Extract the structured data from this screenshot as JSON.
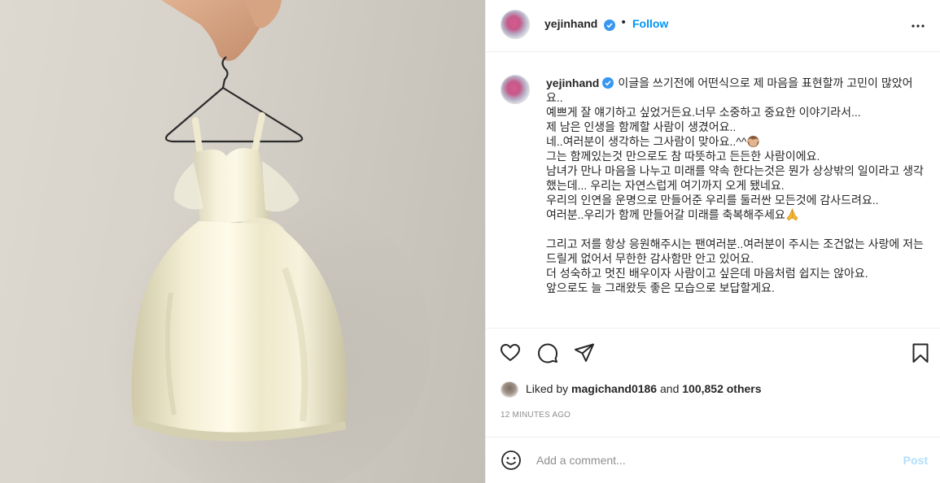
{
  "post": {
    "image_alt": "Miniature ivory satin dress on a wire hanger",
    "author": "yejinhand",
    "follow_label": "Follow",
    "dot": "•",
    "caption_lines": [
      "이글을 쓰기전에 어떤식으로 제 마음을 표현할까 고민이 많았어요..",
      "예쁘게 잘 얘기하고 싶었거든요.너무 소중하고 중요한 이야기라서...",
      "제 남은 인생을 함께할 사람이 생겼어요..",
      "네..여러분이 생각하는 그사람이 맞아요..^^",
      "그는 함께있는것 만으로도 참 따뜻하고 든든한 사람이에요.",
      "남녀가 만나 마음을 나누고 미래를 약속 한다는것은 뭔가 상상밖의 일이라고 생각했는데... 우리는 자연스럽게 여기까지 오게 됐네요.",
      "우리의 인연을 운명으로 만들어준 우리를 둘러싼 모든것에 감사드려요..",
      "여러분..우리가 함께 만들어갈 미래를 축복해주세요",
      "",
      "그리고 저를 항상 응원해주시는 팬여러분..여러분이 주시는 조건없는 사랑에 저는 드릴게 없어서 무한한 감사함만 안고 있어요.",
      "더 성숙하고 멋진 배우이자 사람이고 싶은데 마음처럼 쉽지는 않아요.",
      "앞으로도 늘 그래왔듯 좋은 모습으로 보답할게요."
    ],
    "likes": {
      "prefix": "Liked by",
      "user": "magichand0186",
      "and": "and",
      "others": "100,852 others"
    },
    "timestamp": "12 MINUTES AGO",
    "comment_placeholder": "Add a comment...",
    "post_label": "Post"
  },
  "icons": {
    "verified": "verified-badge-icon",
    "more": "more-options-icon",
    "like": "heart-icon",
    "comment": "comment-icon",
    "share": "paper-plane-icon",
    "save": "bookmark-icon",
    "emoji": "smiley-icon",
    "caption_emoji_1": "see-no-evil-monkey-emoji",
    "caption_emoji_2": "folded-hands-emoji"
  },
  "colors": {
    "accent": "#0095f6",
    "verified": "#3897f0",
    "muted": "#8e8e8e",
    "post_disabled": "#b2dffc"
  }
}
